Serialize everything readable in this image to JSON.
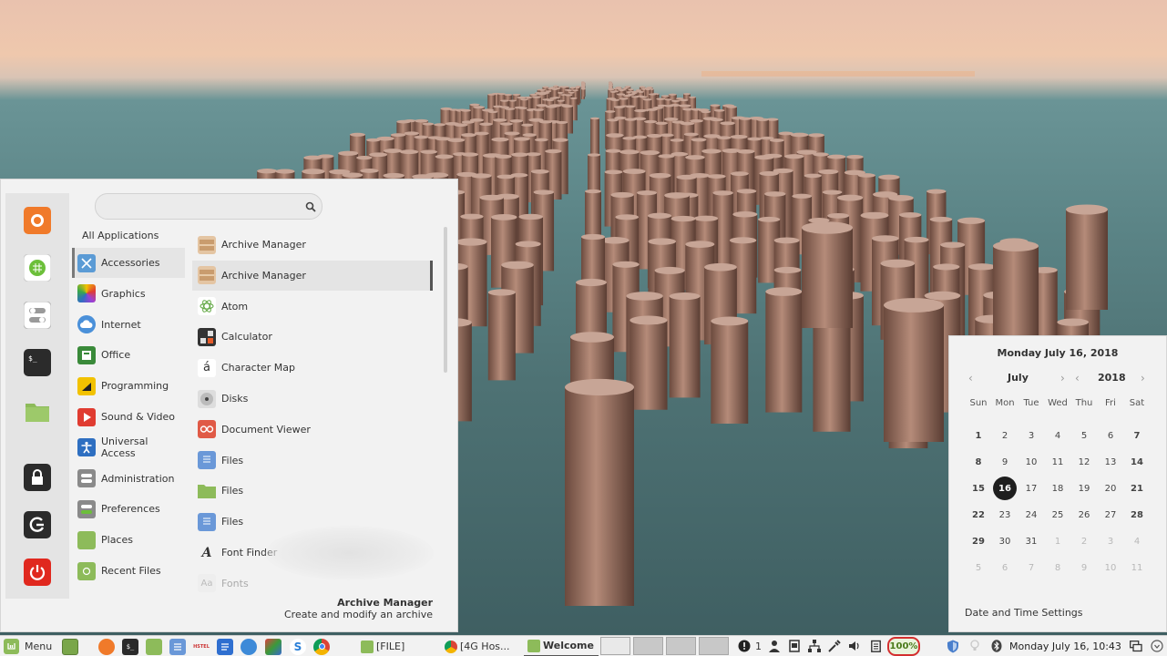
{
  "menu": {
    "search": {
      "placeholder": "",
      "value": ""
    },
    "favorites": [
      {
        "name": "firefox",
        "icon": "firefox-icon"
      },
      {
        "name": "software-manager",
        "icon": "software-manager-icon"
      },
      {
        "name": "settings",
        "icon": "settings-toggle-icon"
      },
      {
        "name": "terminal",
        "icon": "terminal-icon"
      },
      {
        "name": "files",
        "icon": "folder-icon"
      },
      {
        "name": "lock",
        "icon": "lock-icon"
      },
      {
        "name": "logout",
        "icon": "logout-icon"
      },
      {
        "name": "shutdown",
        "icon": "power-icon"
      }
    ],
    "all_applications": "All Applications",
    "categories": [
      {
        "label": "Accessories",
        "icon": "scissors-icon",
        "color": "#5b9bd5"
      },
      {
        "label": "Graphics",
        "icon": "graphics-icon",
        "color": "#e85aa0"
      },
      {
        "label": "Internet",
        "icon": "cloud-icon",
        "color": "#4a90d9"
      },
      {
        "label": "Office",
        "icon": "office-icon",
        "color": "#3a8a3a"
      },
      {
        "label": "Programming",
        "icon": "programming-icon",
        "color": "#f2c200"
      },
      {
        "label": "Sound & Video",
        "icon": "play-icon",
        "color": "#e03c31"
      },
      {
        "label": "Universal Access",
        "icon": "accessibility-icon",
        "color": "#2e6fc1"
      },
      {
        "label": "Administration",
        "icon": "admin-icon",
        "color": "#8a8a8a"
      },
      {
        "label": "Preferences",
        "icon": "preferences-icon",
        "color": "#8a8a8a"
      },
      {
        "label": "Places",
        "icon": "folder-icon",
        "color": "#8dbb5a"
      },
      {
        "label": "Recent Files",
        "icon": "recent-folder-icon",
        "color": "#8dbb5a"
      }
    ],
    "apps": [
      {
        "label": "Archive Manager",
        "icon": "archive-icon"
      },
      {
        "label": "Archive Manager",
        "icon": "archive-icon"
      },
      {
        "label": "Atom",
        "icon": "atom-icon"
      },
      {
        "label": "Calculator",
        "icon": "calculator-icon"
      },
      {
        "label": "Character Map",
        "icon": "character-map-icon"
      },
      {
        "label": "Disks",
        "icon": "disks-icon"
      },
      {
        "label": "Document Viewer",
        "icon": "document-viewer-icon"
      },
      {
        "label": "Files",
        "icon": "files-icon"
      },
      {
        "label": "Files",
        "icon": "folder-icon"
      },
      {
        "label": "Files",
        "icon": "files-icon"
      },
      {
        "label": "Font Finder",
        "icon": "font-finder-icon"
      },
      {
        "label": "Fonts",
        "icon": "fonts-icon"
      }
    ],
    "description": {
      "title": "Archive Manager",
      "text": "Create and modify an archive"
    }
  },
  "calendar": {
    "date_heading": "Monday July 16, 2018",
    "month": "July",
    "year": "2018",
    "weekdays": [
      "Sun",
      "Mon",
      "Tue",
      "Wed",
      "Thu",
      "Fri",
      "Sat"
    ],
    "weeks": [
      [
        "1",
        "2",
        "3",
        "4",
        "5",
        "6",
        "7"
      ],
      [
        "8",
        "9",
        "10",
        "11",
        "12",
        "13",
        "14"
      ],
      [
        "15",
        "16",
        "17",
        "18",
        "19",
        "20",
        "21"
      ],
      [
        "22",
        "23",
        "24",
        "25",
        "26",
        "27",
        "28"
      ],
      [
        "29",
        "30",
        "31",
        "1",
        "2",
        "3",
        "4"
      ],
      [
        "5",
        "6",
        "7",
        "8",
        "9",
        "10",
        "11"
      ]
    ],
    "today": "16",
    "settings_link": "Date and Time Settings"
  },
  "panel": {
    "menu_label": "Menu",
    "windows": [
      {
        "label": "[FILE]",
        "icon": "folder-icon"
      },
      {
        "label": "[4G Hos...",
        "icon": "chrome-icon"
      },
      {
        "label": "Welcome",
        "icon": "mint-icon"
      }
    ],
    "notification_count": "1",
    "battery": "100%",
    "clock": "Monday July 16, 10:43"
  },
  "colors": {
    "accent": "#8dbb5a",
    "battery_ring": "#d32f2f",
    "today_bg": "#1e1e1e"
  }
}
